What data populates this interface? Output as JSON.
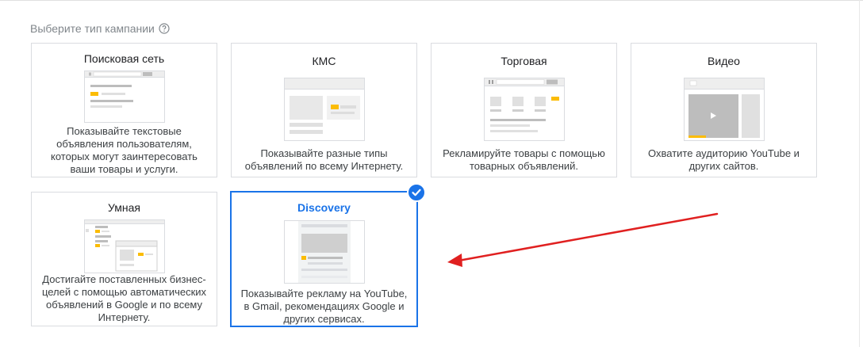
{
  "heading": {
    "label": "Выберите тип кампании"
  },
  "cards": [
    {
      "title": "Поисковая сеть",
      "desc": "Показывайте текстовые объявления пользователям, которых могут заинтересовать ваши товары и услуги."
    },
    {
      "title": "КМС",
      "desc": "Показывайте разные типы объявлений по всему Интернету."
    },
    {
      "title": "Торговая",
      "desc": "Рекламируйте товары с помощью товарных объявлений."
    },
    {
      "title": "Видео",
      "desc": "Охватите аудиторию YouTube и других сайтов."
    },
    {
      "title": "Умная",
      "desc": "Достигайте поставленных бизнес-целей с помощью автоматических объявлений в Google и по всему Интернету."
    },
    {
      "title": "Discovery",
      "desc": "Показывайте рекламу на YouTube, в Gmail, рекомендациях Google и других сервисах.",
      "selected": true
    }
  ],
  "colors": {
    "accent": "#1a73e8",
    "highlight": "#fbbc04",
    "arrow": "#e02020"
  }
}
